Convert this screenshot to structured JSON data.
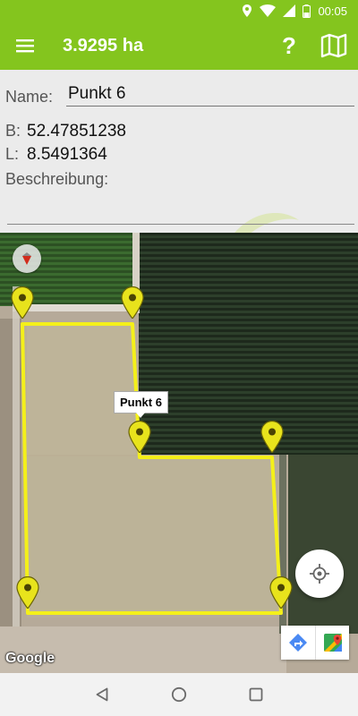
{
  "status_bar": {
    "time": "00:05",
    "icons": [
      "location-icon",
      "wifi-icon",
      "signal-icon",
      "battery-icon"
    ]
  },
  "app_bar": {
    "title": "3.9295 ha",
    "help_label": "?",
    "icons": [
      "menu-icon",
      "help-icon",
      "map-icon"
    ]
  },
  "form": {
    "name_label": "Name:",
    "name_value": "Punkt 6",
    "b_label": "B:",
    "b_value": "52.47851238",
    "l_label": "L:",
    "l_value": "8.5491364",
    "description_label": "Beschreibung:",
    "description_value": ""
  },
  "map": {
    "selected_marker_label": "Punkt 6",
    "attribution": "Google",
    "marker_count": 7,
    "boundary_color": "#f4f01a",
    "marker_color": "#e8e31c",
    "icons": [
      "compass-icon",
      "my-location-icon",
      "directions-icon",
      "google-maps-icon"
    ]
  },
  "nav_bar": {
    "icons": [
      "back-icon",
      "home-icon",
      "recents-icon"
    ]
  },
  "colors": {
    "accent": "#84c51e",
    "form_background": "#ebebeb"
  }
}
